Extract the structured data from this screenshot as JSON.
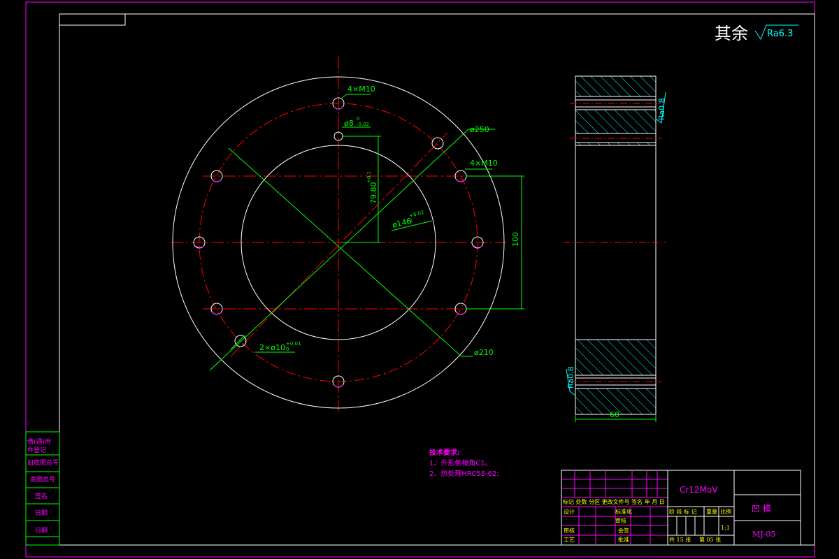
{
  "surface_finish": {
    "label": "其余",
    "ra": "Ra6.3"
  },
  "front_view": {
    "dims": {
      "holes_m10_top": "4×M10",
      "holes_m10_right": "4×M10",
      "pin_hole": "ø8",
      "pin_hole_tol_upper": "0",
      "pin_hole_tol_lower": "-0.02",
      "dia_250": "ø250",
      "dia_210": "ø210",
      "dia_146": "ø146",
      "dia_146_tol_upper": "+0.02",
      "dia_146_tol_lower": "0",
      "dim_79_8": "79.80",
      "dim_79_8_tol": "+0.1",
      "dim_100": "100",
      "dowel_holes": "2×ø10",
      "dowel_tol_upper": "+0.01",
      "dowel_tol_lower": "0"
    }
  },
  "side_view": {
    "ra_top": "Ra0.8",
    "ra_bottom": "Ra0.8",
    "width": "60"
  },
  "tech_requirements": {
    "title": "技术要求:",
    "items": [
      "1、外形倒棱角C1。",
      "2、热处理HRC58-62;"
    ]
  },
  "left_strip": {
    "labels": [
      "借(通)用",
      "件登记",
      "旧底图总号",
      "底图总号",
      "签名",
      "日期",
      "日期"
    ]
  },
  "title_block": {
    "material": "Cr12MoV",
    "part_name": "凹  模",
    "drawing_no": "MJ-05",
    "header_row": "标记 处数  分区  更改文件号 签名 年 月 日",
    "design": "设计",
    "standard": "标准化",
    "review": "审核",
    "process": "工艺",
    "std_check": "审核",
    "approve": "批准",
    "counter_sign": "会签",
    "stage_label": "阶 段 标 记",
    "weight_label": "重量",
    "scale_label": "比例",
    "scale_value": "1:1",
    "sheets": "共 15 张",
    "sheet_no": "第 05 张"
  }
}
